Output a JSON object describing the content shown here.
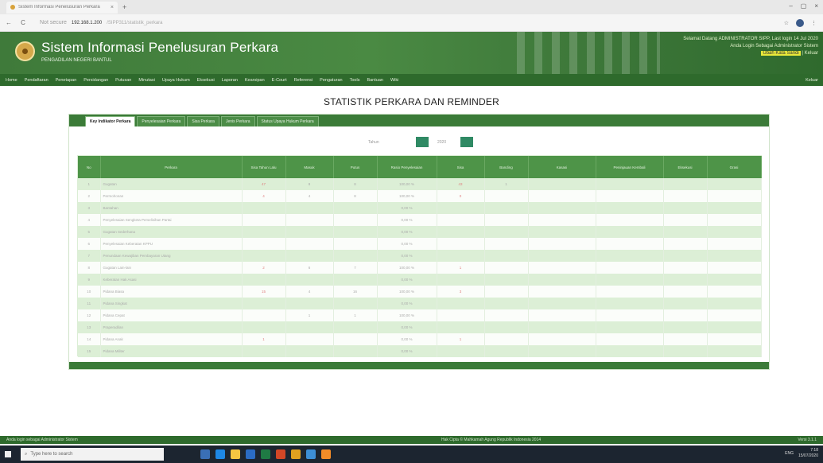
{
  "browser": {
    "tab_title": "Sistem Informasi Penelusuran Perkara",
    "tab_close": "×",
    "new_tab": "+",
    "back": "←",
    "reload": "C",
    "security": "Not secure",
    "url": "192.168.1.200",
    "url_path": "/SIPP311/statistik_perkara",
    "minimize": "–",
    "maximize": "▢",
    "close": "×",
    "star": "☆",
    "ext": "⋮"
  },
  "header": {
    "title": "Sistem Informasi Penelusuran Perkara",
    "subtitle": "PENGADILAN NEGERI BANTUL",
    "welcome1": "Selamat Datang ADMINISTRATOR SIPP, Last login 14 Jul 2020",
    "welcome2": "Anda Login Sebagai Administrator Sistem",
    "welcome3": "Ubah Kata Sandi",
    "welcome3b": " | Keluar"
  },
  "menu": {
    "items": [
      "Home",
      "Pendaftaran",
      "Penetapan",
      "Persidangan",
      "Putusan",
      "Minutasi",
      "Upaya Hukum",
      "Eksekusi",
      "Laporan",
      "Kearsipan",
      "E-Court",
      "Referensi",
      "Pengaturan",
      "Tools",
      "Bantuan",
      "Wiki"
    ],
    "right": "Keluar"
  },
  "page": {
    "title": "STATISTIK PERKARA DAN REMINDER"
  },
  "card": {
    "tabs": [
      "Key Indikator Perkara",
      "Penyelesaian Perkara",
      "Sisa Perkara",
      "Jenis Perkara",
      "Status Upaya Hukum Perkara"
    ],
    "pager_label1": "Tahun",
    "pager_label2": "2020"
  },
  "table": {
    "headers": [
      "No",
      "Perkara",
      "Sisa Tahun Lalu",
      "Masuk",
      "Putus",
      "Rasio Penyelesaian",
      "Sisa",
      "Banding",
      "Kasasi",
      "Peninjauan Kembali",
      "Eksekusi",
      "Grasi"
    ],
    "rows": [
      [
        "1",
        "Gugatan",
        "47",
        "8",
        "8",
        "100,00 %",
        "43",
        "1",
        "",
        "",
        "",
        ""
      ],
      [
        "2",
        "Permohonan",
        "4",
        "4",
        "8",
        "100,00 %",
        "0",
        "",
        "",
        "",
        "",
        ""
      ],
      [
        "3",
        "Bantahan",
        "",
        "",
        "",
        "0,00 %",
        "",
        "",
        "",
        "",
        "",
        ""
      ],
      [
        "4",
        "Penyelesaian Sengketa Perselisihan Partai",
        "",
        "",
        "",
        "0,00 %",
        "",
        "",
        "",
        "",
        "",
        ""
      ],
      [
        "5",
        "Gugatan Sederhana",
        "",
        "",
        "",
        "0,00 %",
        "",
        "",
        "",
        "",
        "",
        ""
      ],
      [
        "6",
        "Penyelesaian Keberatan KPPU",
        "",
        "",
        "",
        "0,00 %",
        "",
        "",
        "",
        "",
        "",
        ""
      ],
      [
        "7",
        "Penundaan Kewajiban Pembayaran Utang",
        "",
        "",
        "",
        "0,00 %",
        "",
        "",
        "",
        "",
        "",
        ""
      ],
      [
        "8",
        "Gugatan Lain-lain",
        "2",
        "6",
        "7",
        "100,00 %",
        "1",
        "",
        "",
        "",
        "",
        ""
      ],
      [
        "9",
        "Keberatan Hak Asasi",
        "",
        "",
        "",
        "0,00 %",
        "",
        "",
        "",
        "",
        "",
        ""
      ],
      [
        "10",
        "Pidana Biasa",
        "15",
        "4",
        "16",
        "100,00 %",
        "3",
        "",
        "",
        "",
        "",
        ""
      ],
      [
        "11",
        "Pidana Singkat",
        "",
        "",
        "",
        "0,00 %",
        "",
        "",
        "",
        "",
        "",
        ""
      ],
      [
        "12",
        "Pidana Cepat",
        "",
        "1",
        "1",
        "100,00 %",
        "",
        "",
        "",
        "",
        "",
        ""
      ],
      [
        "13",
        "Praperadilan",
        "",
        "",
        "",
        "0,00 %",
        "",
        "",
        "",
        "",
        "",
        ""
      ],
      [
        "14",
        "Pidana Anak",
        "1",
        "",
        "",
        "0,00 %",
        "1",
        "",
        "",
        "",
        "",
        ""
      ],
      [
        "15",
        "Pidana Militer",
        "",
        "",
        "",
        "0,00 %",
        "",
        "",
        "",
        "",
        "",
        ""
      ]
    ]
  },
  "statusbar": {
    "left": "Anda login sebagai Administrator Sistem",
    "mid": "Hak Cipta © Mahkamah Agung Republik Indonesia 2014",
    "right": "Versi 3.1.1"
  },
  "taskbar": {
    "search_placeholder": "Type here to search",
    "time": "7:18",
    "date": "15/07/2020",
    "lang": "ENG"
  },
  "colors": {
    "brand_green": "#3f7a3a",
    "menu_green": "#2e6a2c",
    "pager_teal": "#2f8a64"
  }
}
